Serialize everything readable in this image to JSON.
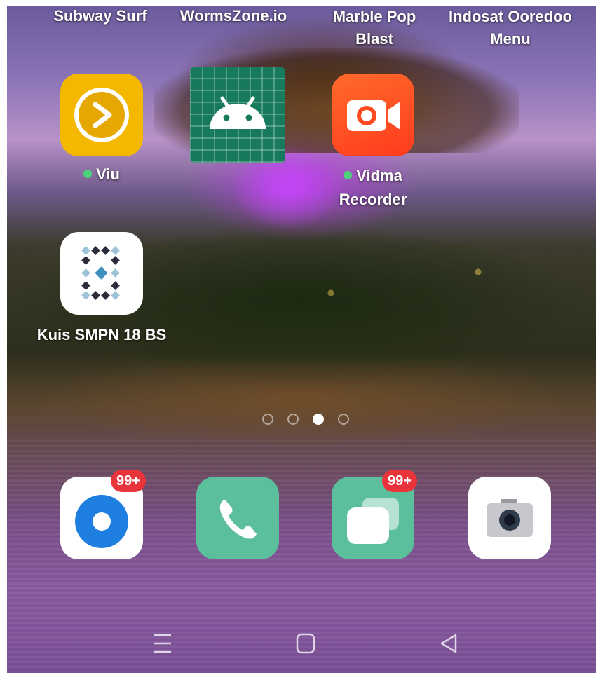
{
  "top_row": [
    {
      "label": "Subway Surf"
    },
    {
      "label": "WormsZone.io"
    },
    {
      "label": "Marble Pop Blast"
    },
    {
      "label": "Indosat Ooredoo Menu"
    }
  ],
  "apps": {
    "viu": {
      "label": "Viu",
      "icon": "viu-play-icon",
      "color": "#f5b800"
    },
    "android": {
      "label": "",
      "icon": "android-icon",
      "color": "#187a5c"
    },
    "vidma": {
      "label": "Vidma Recorder",
      "icon": "video-camera-icon",
      "color": "#ff4a22"
    },
    "kuis": {
      "label": "Kuis SMPN 18 BS",
      "icon": "diamond-grid-icon",
      "color": "#ffffff"
    }
  },
  "page_indicator": {
    "total": 4,
    "current": 3
  },
  "dock": [
    {
      "name": "browser",
      "icon": "browser-icon",
      "badge": "99+",
      "color": "#ffffff"
    },
    {
      "name": "phone",
      "icon": "phone-icon",
      "badge": "",
      "color": "#5cbf9c"
    },
    {
      "name": "messages",
      "icon": "messages-icon",
      "badge": "99+",
      "color": "#5cbf9c"
    },
    {
      "name": "camera",
      "icon": "camera-icon",
      "badge": "",
      "color": "#ffffff"
    }
  ],
  "navbar": {
    "menu_icon": "menu-icon",
    "home_icon": "home-icon",
    "back_icon": "back-icon"
  }
}
